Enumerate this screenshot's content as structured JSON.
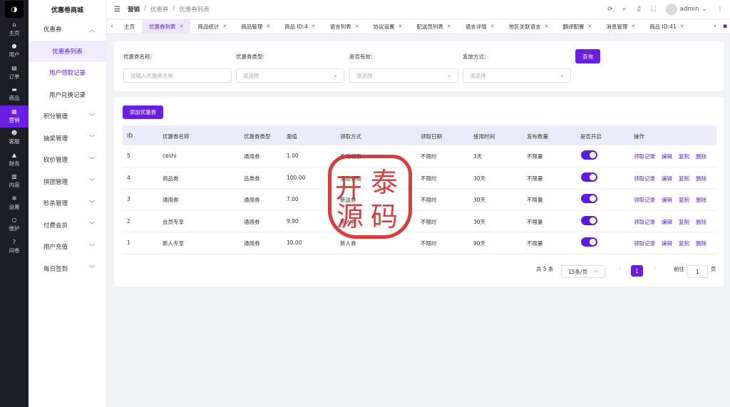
{
  "rail": {
    "logo": "◑",
    "items": [
      {
        "icon": "home-icon",
        "glyph": "⌂",
        "label": "主页"
      },
      {
        "icon": "user-icon",
        "glyph": "●",
        "label": "用户"
      },
      {
        "icon": "order-icon",
        "glyph": "▤",
        "label": "订单"
      },
      {
        "icon": "goods-icon",
        "glyph": "▬",
        "label": "商品"
      },
      {
        "icon": "marketing-icon",
        "glyph": "▦",
        "label": "营销"
      },
      {
        "icon": "service-icon",
        "glyph": "☻",
        "label": "客服"
      },
      {
        "icon": "finance-icon",
        "glyph": "▲",
        "label": "财务"
      },
      {
        "icon": "content-icon",
        "glyph": "▥",
        "label": "内容"
      },
      {
        "icon": "settings-icon",
        "glyph": "✲",
        "label": "设置"
      },
      {
        "icon": "maintain-icon",
        "glyph": "○",
        "label": "维护"
      },
      {
        "icon": "question-icon",
        "glyph": "?",
        "label": "问卷"
      }
    ]
  },
  "sidebar": {
    "brand": "优惠卷商城",
    "groups": [
      {
        "label": "优惠券",
        "chev": "^"
      },
      {
        "label": "积分管理",
        "chev": "v"
      },
      {
        "label": "抽奖管理",
        "chev": "v"
      },
      {
        "label": "砍价管理",
        "chev": "v"
      },
      {
        "label": "拼团管理",
        "chev": "v"
      },
      {
        "label": "秒杀管理",
        "chev": "v"
      },
      {
        "label": "付费会员",
        "chev": "v"
      },
      {
        "label": "用户充值",
        "chev": "v"
      },
      {
        "label": "每日签到",
        "chev": "v"
      }
    ],
    "subs": [
      "优惠券列表",
      "用户领取记录",
      "用户兑换记录"
    ]
  },
  "header": {
    "breadcrumb": [
      "营销",
      "优惠券",
      "优惠券列表"
    ],
    "sep": "/",
    "user": "admin",
    "icons": [
      "C",
      "Q",
      "🔔",
      "⛶"
    ]
  },
  "tabs": [
    "主页",
    "优惠券列表",
    "商品统计",
    "商品管理",
    "商品 ID:4",
    "语言列表",
    "协议设置",
    "配送员列表",
    "语言详情",
    "地区关联语言",
    "翻译配置",
    "消息管理",
    "商品 ID:41"
  ],
  "filter": {
    "name_label": "优惠券名称:",
    "name_placeholder": "请输入优惠券名称",
    "type_label": "优惠券类型:",
    "type_placeholder": "请选择",
    "valid_label": "是否有效:",
    "valid_placeholder": "请选择",
    "issue_label": "发放方式:",
    "issue_placeholder": "请选择",
    "query": "查询"
  },
  "list": {
    "add": "添加优惠券",
    "columns": [
      "ID",
      "优惠券名称",
      "优惠券类型",
      "面值",
      "领取方式",
      "领取日期",
      "使用时间",
      "发布数量",
      "是否开启",
      "操作"
    ],
    "rows": [
      [
        "5",
        "ceshi",
        "通用券",
        "1.00",
        "手动领取",
        "不限时",
        "3天",
        "不限量"
      ],
      [
        "4",
        "商品券",
        "品类券",
        "100.00",
        "手动领取",
        "不限时",
        "30天",
        "不限量"
      ],
      [
        "3",
        "通用券",
        "通用券",
        "7.00",
        "新送券",
        "不限时",
        "30天",
        "不限量"
      ],
      [
        "2",
        "会员专享",
        "通用券",
        "9.90",
        "新人券",
        "不限时",
        "30天",
        "不限量"
      ],
      [
        "1",
        "新人专享",
        "通用券",
        "10.00",
        "新人券",
        "不限时",
        "90天",
        "不限量"
      ]
    ],
    "actions": [
      "领取记录",
      "编辑",
      "复制",
      "删除"
    ]
  },
  "pagination": {
    "total": "共 5 条",
    "size": "15条/页",
    "page": "1",
    "goto": "前往",
    "goto_val": "1",
    "unit": "页"
  },
  "stamp": [
    "开",
    "泰",
    "源",
    "码"
  ],
  "colors": {
    "accent": "#6a1fe0",
    "rail": "#1d1e23",
    "stamp": "#d21b1b"
  }
}
